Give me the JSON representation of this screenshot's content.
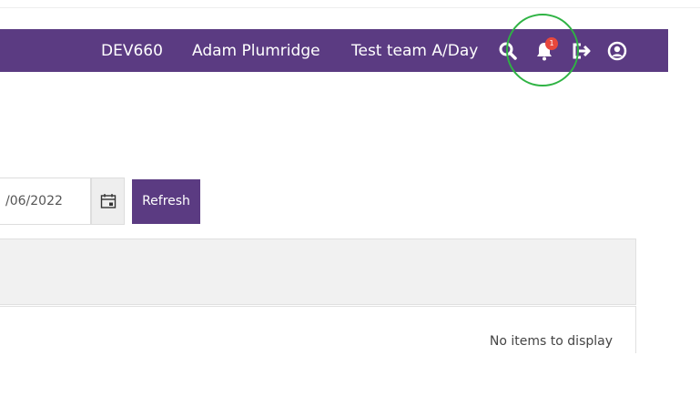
{
  "navbar": {
    "env_label": "DEV660",
    "user_name": "Adam Plumridge",
    "team_label": "Test team A/Day",
    "notification_count": "1",
    "background_color": "#5b3b82",
    "icons": [
      "search-icon",
      "bell-icon",
      "logout-icon",
      "user-circle-icon"
    ]
  },
  "filters": {
    "date_value": "/06/2022",
    "refresh_label": "Refresh"
  },
  "grid": {
    "empty_message": "No items to display"
  },
  "colors": {
    "accent": "#5b3b82",
    "badge": "#e8483c",
    "highlight": "#2fb344"
  }
}
